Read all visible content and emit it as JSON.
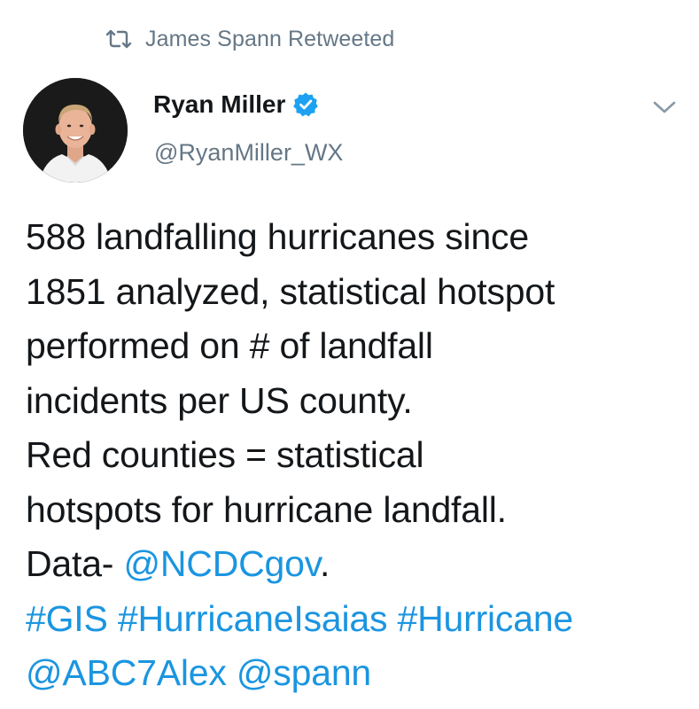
{
  "retweet": {
    "label": "James Spann Retweeted",
    "icon": "retweet-icon"
  },
  "author": {
    "display_name": "Ryan Miller",
    "handle": "@RyanMiller_WX",
    "verified": true,
    "avatar": "avatar"
  },
  "menu": {
    "icon": "chevron-down-icon"
  },
  "tweet": {
    "lines": [
      "588 landfalling hurricanes since",
      "1851 analyzed, statistical hotspot",
      "performed on # of landfall",
      "incidents per US county.",
      "Red counties = statistical",
      "hotspots for hurricane landfall."
    ],
    "data_prefix": "Data- ",
    "data_mention": "@NCDCgov",
    "data_suffix": ".",
    "hashtags": [
      "#GIS",
      "#HurricaneIsaias",
      "#Hurricane"
    ],
    "mentions": [
      "@ABC7Alex",
      "@spann"
    ]
  },
  "colors": {
    "text": "#14171a",
    "secondary": "#657786",
    "link": "#1b95e0",
    "verified": "#1da1f2"
  }
}
